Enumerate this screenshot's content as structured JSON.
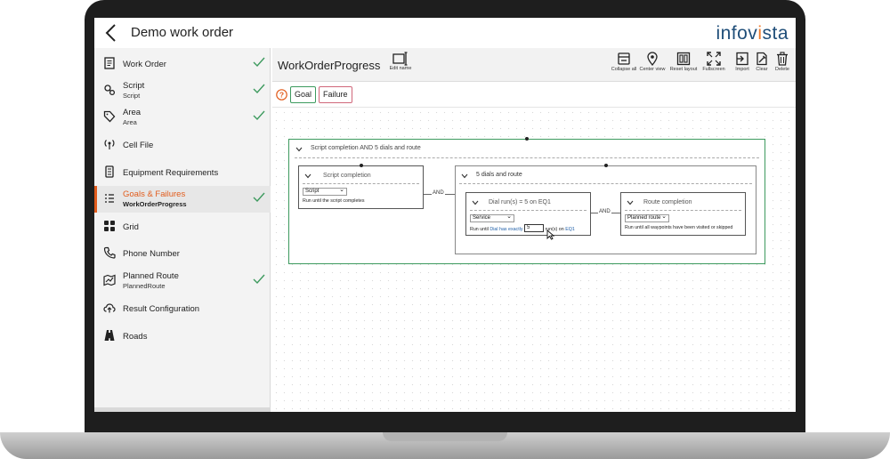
{
  "header": {
    "title": "Demo work order",
    "logo": "infovista"
  },
  "sidebar": {
    "items": [
      {
        "label": "Work Order",
        "sub": "",
        "icon": "document-icon",
        "checked": true
      },
      {
        "label": "Script",
        "sub": "Script",
        "icon": "script-icon",
        "checked": true
      },
      {
        "label": "Area",
        "sub": "Area",
        "icon": "tag-icon",
        "checked": true
      },
      {
        "label": "Cell File",
        "sub": "",
        "icon": "antenna-icon",
        "checked": false
      },
      {
        "label": "Equipment Requirements",
        "sub": "",
        "icon": "device-icon",
        "checked": false
      },
      {
        "label": "Goals & Failures",
        "sub": "WorkOrderProgress",
        "icon": "list-icon",
        "checked": true,
        "active": true
      },
      {
        "label": "Grid",
        "sub": "",
        "icon": "grid-icon",
        "checked": false
      },
      {
        "label": "Phone Number",
        "sub": "",
        "icon": "phone-icon",
        "checked": false
      },
      {
        "label": "Planned Route",
        "sub": "PlannedRoute",
        "icon": "map-icon",
        "checked": true
      },
      {
        "label": "Result Configuration",
        "sub": "",
        "icon": "cloud-upload-icon",
        "checked": false
      },
      {
        "label": "Roads",
        "sub": "",
        "icon": "road-icon",
        "checked": false
      }
    ]
  },
  "main": {
    "title": "WorkOrderProgress",
    "edit_name_label": "Edit name",
    "tools": [
      {
        "label": "Collapse all",
        "icon": "collapse-icon"
      },
      {
        "label": "Center view",
        "icon": "location-pin-icon"
      },
      {
        "label": "Reset layout",
        "icon": "reset-layout-icon"
      },
      {
        "label": "Fullscreen",
        "icon": "fullscreen-icon"
      },
      {
        "label": "Import",
        "icon": "import-icon"
      },
      {
        "label": "Clear",
        "icon": "clear-icon"
      },
      {
        "label": "Delete",
        "icon": "trash-icon"
      }
    ],
    "tags": {
      "goal": "Goal",
      "failure": "Failure"
    }
  },
  "diagram": {
    "root_title": "Script completion AND 5 dials and route",
    "and_label": "AND",
    "script_node": {
      "title": "Script completion",
      "select": "Script",
      "desc": "Run until the script completes"
    },
    "group": {
      "title": "5 dials and route"
    },
    "dial_node": {
      "title": "Dial run(s) = 5 on EQ1",
      "select": "Service",
      "desc_pre": "Run until",
      "desc_hl1": "Dial",
      "desc_mid": "has exactly",
      "count": "5",
      "desc_post": "run(s)",
      "desc_on": "on",
      "desc_hl2": "EQ1"
    },
    "route_node": {
      "title": "Route completion",
      "select": "Planned route",
      "desc": "Run until all waypoints have been visited or skipped"
    }
  },
  "colors": {
    "accent": "#e25c1c",
    "goal": "#3d9a5e",
    "failure": "#d0677a",
    "brand": "#1f4e79"
  }
}
